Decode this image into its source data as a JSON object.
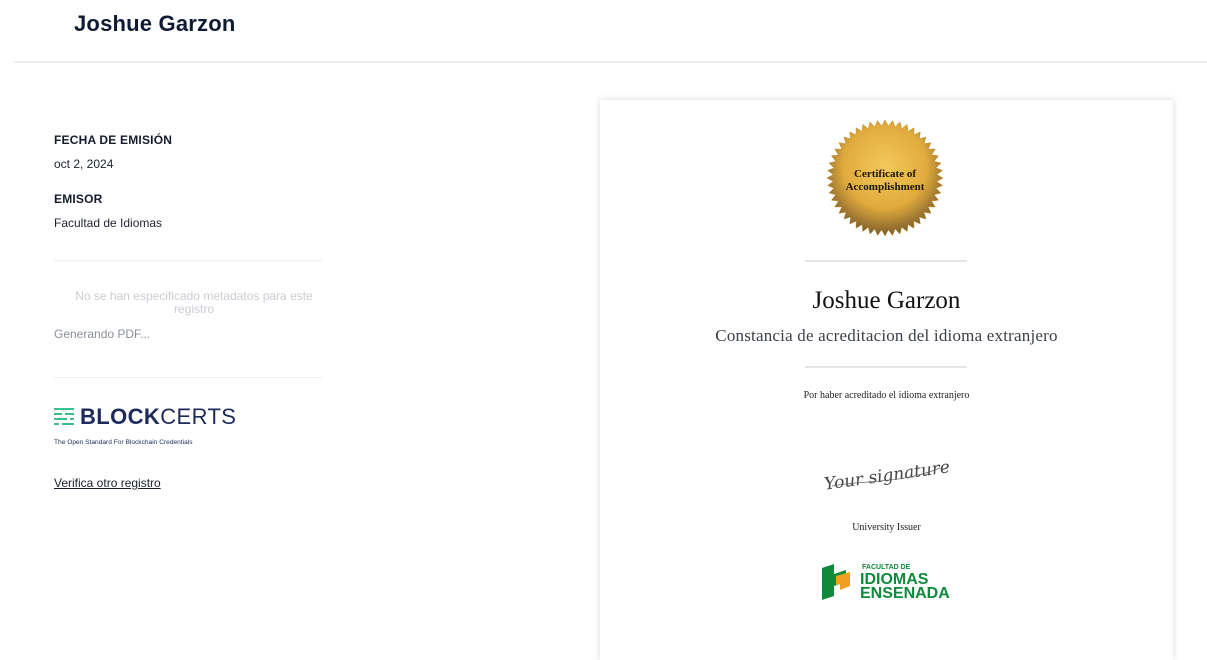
{
  "header": {
    "title": "Joshue Garzon"
  },
  "details": {
    "issue_date_label": "FECHA DE EMISIÓN",
    "issue_date_value": "oct 2, 2024",
    "issuer_label": "EMISOR",
    "issuer_value": "Facultad de Idiomas",
    "metadata_note": "No se han especificado metadatos para este registro",
    "pdf_status": "Generando PDF..."
  },
  "branding": {
    "blockcerts_bold": "BLOCK",
    "blockcerts_light": "CERTS",
    "blockcerts_tagline": "The Open Standard For Blockchain Credentials",
    "blockcerts_color": "#1d2a5a",
    "accent_color": "#3bbf8a"
  },
  "actions": {
    "verify_other": "Verifica otro registro"
  },
  "certificate": {
    "seal_line1": "Certificate of",
    "seal_line2": "Accomplishment",
    "recipient_name": "Joshue Garzon",
    "title": "Constancia de acreditacion del idioma extranjero",
    "description": "Por haber acreditado el idioma extranjero",
    "signature_text": "Your signature",
    "signer_title": "University Issuer",
    "faculty_small": "FACULTAD DE",
    "faculty_line1": "IDIOMAS",
    "faculty_line2": "ENSENADA",
    "seal_color": "#e0ab3c",
    "faculty_green": "#0f8a3b",
    "faculty_orange": "#f0a020"
  }
}
